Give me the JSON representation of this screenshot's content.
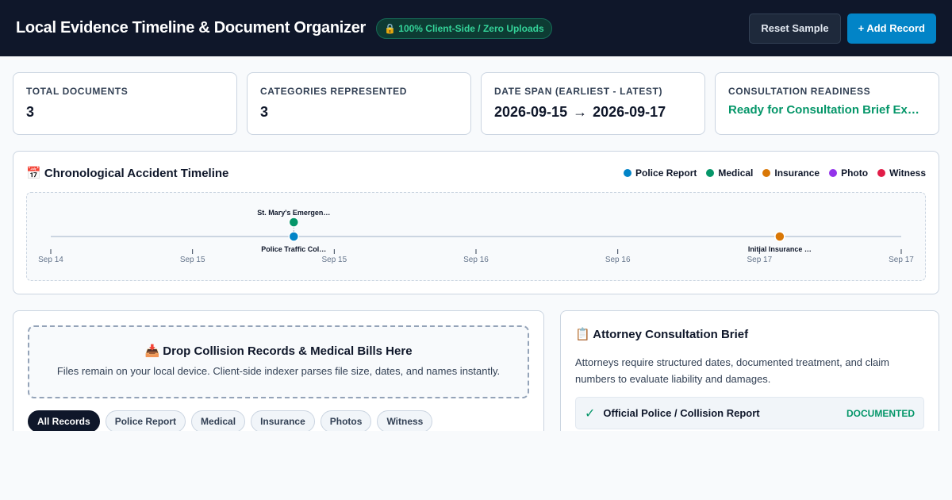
{
  "header": {
    "title": "Local Evidence Timeline & Document Organizer",
    "privacy_badge": "🔒 100% Client-Side / Zero Uploads",
    "reset_label": "Reset Sample",
    "add_label": "+ Add Record"
  },
  "stats": [
    {
      "label": "Total Documents",
      "value": "3"
    },
    {
      "label": "Categories Represented",
      "value": "3"
    },
    {
      "label": "Date Span (Earliest - Latest)",
      "start": "2026-09-15",
      "arrow": "→",
      "end": "2026-09-17"
    },
    {
      "label": "Consultation Readiness",
      "value": "Ready for Consultation Brief Ex…"
    }
  ],
  "timeline": {
    "title": "📅 Chronological Accident Timeline",
    "legend": [
      {
        "label": "Police Report",
        "color": "#0284c7"
      },
      {
        "label": "Medical",
        "color": "#059669"
      },
      {
        "label": "Insurance",
        "color": "#d97706"
      },
      {
        "label": "Photo",
        "color": "#9333ea"
      },
      {
        "label": "Witness",
        "color": "#e11d48"
      }
    ],
    "ticks": [
      "Sep 14",
      "Sep 15",
      "Sep 15",
      "Sep 16",
      "Sep 16",
      "Sep 17",
      "Sep 17"
    ],
    "events": [
      {
        "label": "Police Traffic Col…",
        "category": "Police Report",
        "color": "#0284c7",
        "date": "2026-09-15",
        "stack": 0
      },
      {
        "label": "St. Mary's Emergen…",
        "category": "Medical",
        "color": "#059669",
        "date": "2026-09-15",
        "stack": 1
      },
      {
        "label": "Initial Insurance …",
        "category": "Insurance",
        "color": "#d97706",
        "date": "2026-09-17",
        "stack": 0
      }
    ]
  },
  "dropzone": {
    "title": "📥 Drop Collision Records & Medical Bills Here",
    "subtitle": "Files remain on your local device. Client-side indexer parses file size, dates, and names instantly."
  },
  "filters": [
    "All Records",
    "Police Report",
    "Medical",
    "Insurance",
    "Photos",
    "Witness"
  ],
  "active_filter": "All Records",
  "brief": {
    "title": "📋 Attorney Consultation Brief",
    "description": "Attorneys require structured dates, documented treatment, and claim numbers to evaluate liability and damages.",
    "items": [
      {
        "check": "✓",
        "label": "Official Police / Collision Report",
        "status": "DOCUMENTED"
      }
    ]
  }
}
